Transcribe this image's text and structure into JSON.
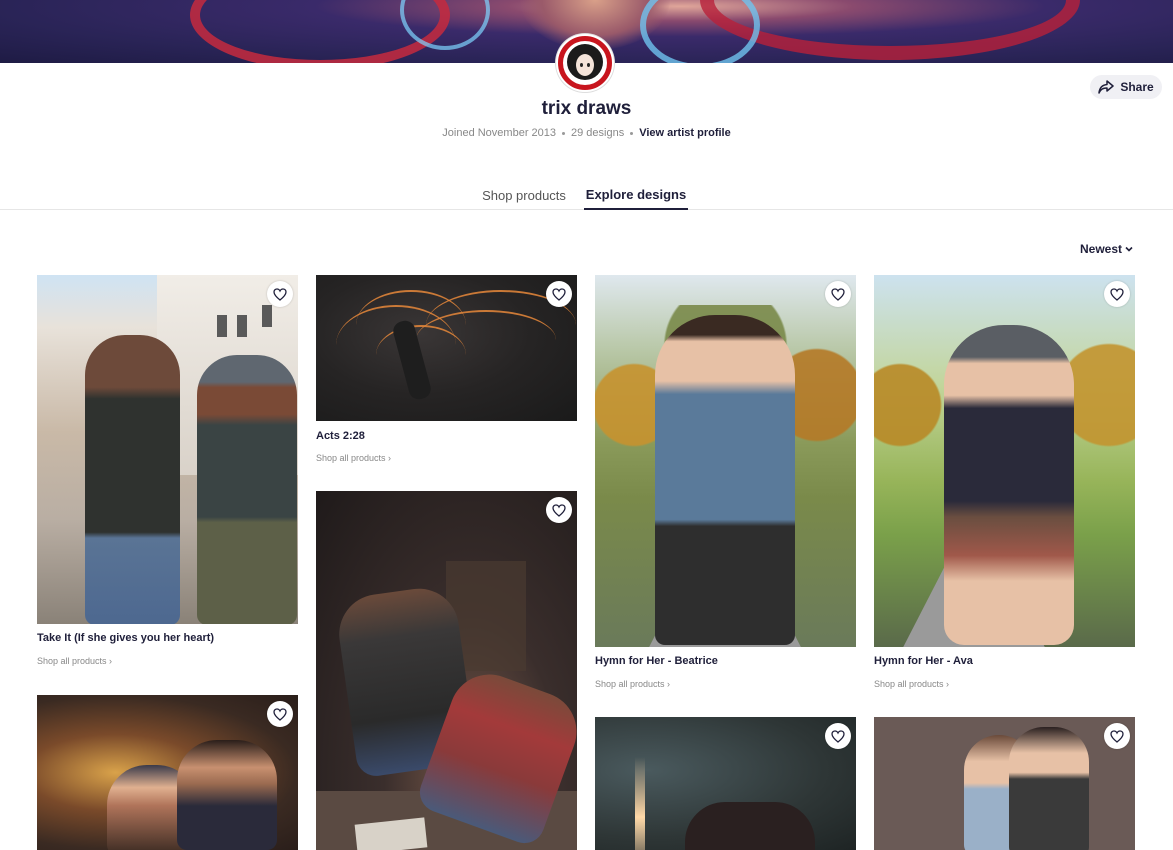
{
  "artist": {
    "name": "trix draws",
    "joined": "Joined November 2013",
    "designs_count": "29 designs",
    "profile_link": "View artist profile"
  },
  "share": {
    "label": "Share",
    "icon": "share-arrow-icon"
  },
  "tabs": [
    {
      "label": "Shop products",
      "active": false
    },
    {
      "label": "Explore designs",
      "active": true
    }
  ],
  "sort": {
    "label": "Newest",
    "icon": "chevron-down-icon"
  },
  "designs": [
    {
      "title": "Take It (If she gives you her heart)",
      "link": "Shop all products ›"
    },
    {
      "title": "Acts 2:28",
      "link": "Shop all products ›"
    },
    {
      "title": "Hymn for Her - Beatrice",
      "link": "Shop all products ›"
    },
    {
      "title": "Hymn for Her - Ava",
      "link": "Shop all products ›"
    }
  ],
  "colors": {
    "text": "#1f1f3a",
    "muted": "#888888",
    "avatar_ring": "#c8151e",
    "tab_underline": "#1f1f3a"
  }
}
